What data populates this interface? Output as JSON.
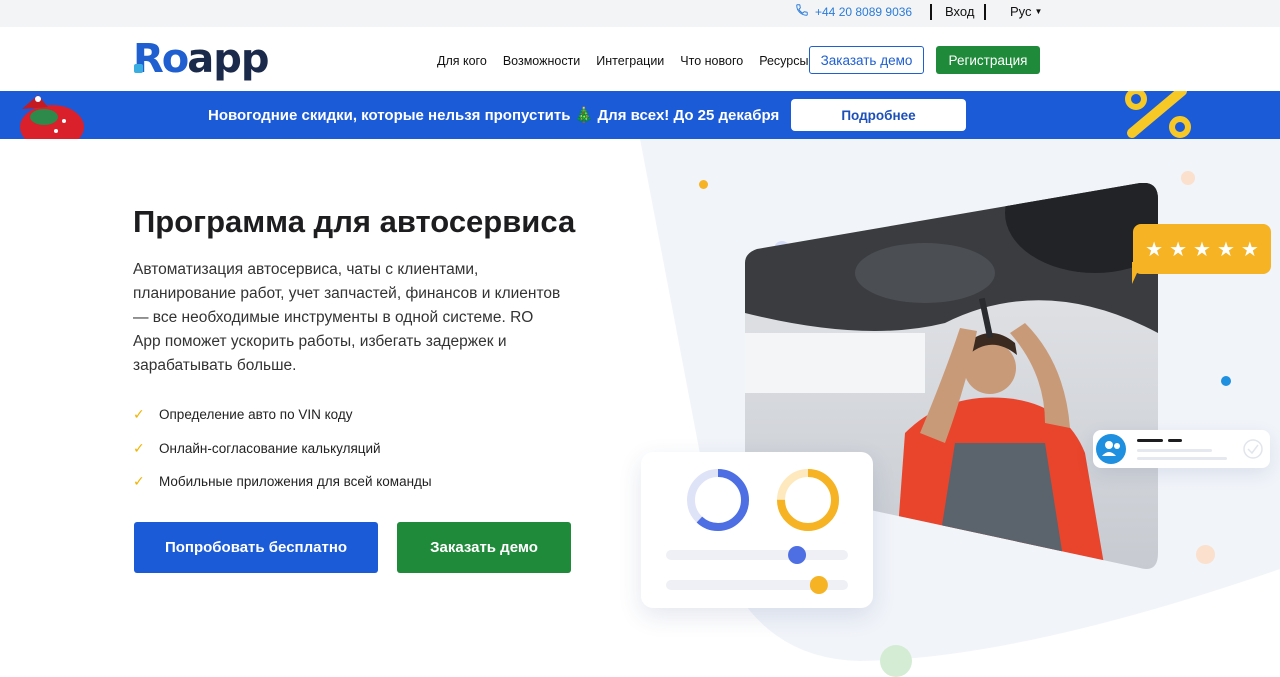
{
  "topbar": {
    "phone": "+44 20 8089 9036",
    "login": "Вход",
    "language": "Рус"
  },
  "header": {
    "logo_ro": "Ro",
    "logo_app": "app",
    "nav": [
      "Для кого",
      "Возможности",
      "Интеграции",
      "Что нового",
      "Ресурсы"
    ],
    "demo_button": "Заказать демо",
    "register_button": "Регистрация"
  },
  "promo": {
    "text": "Новогодние скидки, которые нельзя пропустить 🎄 Для всех! До 25 декабря",
    "button": "Подробнее"
  },
  "hero": {
    "title": "Программа для автосервиса",
    "lead": "Автоматизация автосервиса, чаты с клиентами, планирование работ, учет запчастей, финансов и клиентов — все необходимые инструменты в одной системе. RO App поможет ускорить работы, избегать задержек и зарабатывать больше.",
    "features": [
      "Определение авто по VIN коду",
      "Онлайн-согласование калькуляций",
      "Мобильные приложения для всей команды"
    ],
    "try_button": "Попробовать бесплатно",
    "demo_button": "Заказать демо"
  },
  "rating": {
    "stars": 5
  },
  "stats_card": {
    "donut1": 0.62,
    "donut2": 0.75,
    "slider1": 0.72,
    "slider2": 0.84
  },
  "colors": {
    "brand_blue": "#1c5bd8",
    "brand_green": "#1f8a3a",
    "accent_yellow": "#f6b323"
  }
}
